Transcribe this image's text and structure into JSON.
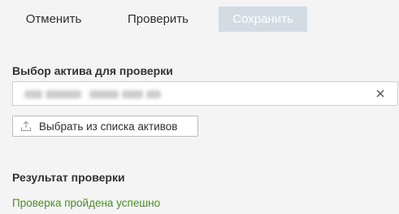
{
  "toolbar": {
    "cancel_label": "Отменить",
    "check_label": "Проверить",
    "save_label": "Сохранить"
  },
  "asset": {
    "section_label": "Выбор актива для проверки",
    "pick_button_label": "Выбрать из списка активов"
  },
  "result": {
    "section_label": "Результат проверки",
    "status_text": "Проверка пройдена успешно"
  },
  "icons": {
    "clear": "close-icon",
    "pick": "upload-icon"
  },
  "colors": {
    "background": "#f4f4f4",
    "disabled_button": "#d3dbe3",
    "success_text": "#4e8a2c"
  }
}
